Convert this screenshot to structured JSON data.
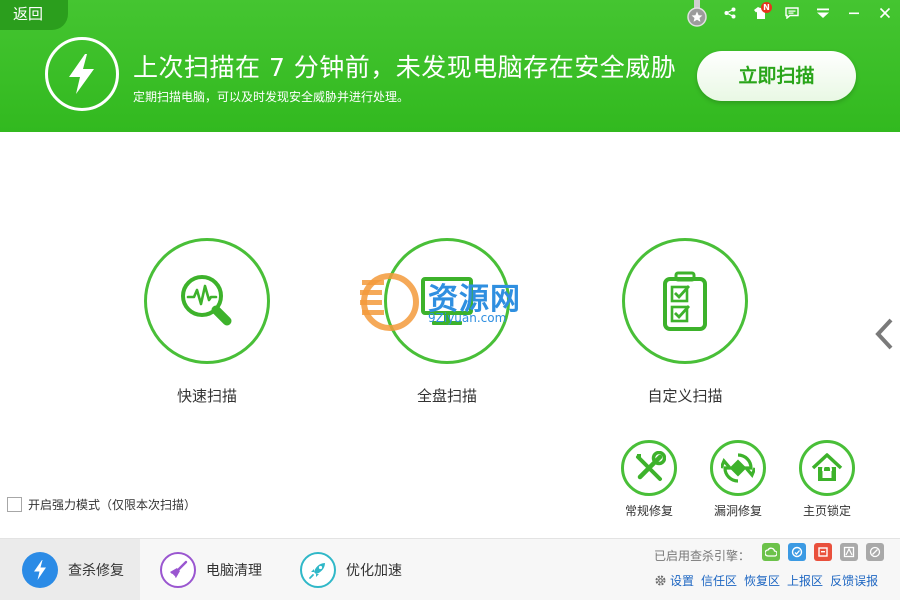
{
  "header": {
    "back_label": "返回",
    "title": "上次扫描在 7 分钟前，未发现电脑存在安全威胁",
    "subtitle": "定期扫描电脑，可以及时发现安全威胁并进行处理。",
    "scan_now_label": "立即扫描",
    "notification_badge": "N",
    "theme_color": "#3cbf28"
  },
  "scan_modes": [
    {
      "label": "快速扫描",
      "icon": "magnifier-pulse-icon"
    },
    {
      "label": "全盘扫描",
      "icon": "monitor-icon"
    },
    {
      "label": "自定义扫描",
      "icon": "clipboard-check-icon"
    }
  ],
  "watermark": {
    "text": "资源网",
    "url": "9Ziyuan.com"
  },
  "strong_mode": {
    "label": "开启强力模式（仅限本次扫描）",
    "checked": false
  },
  "tools": [
    {
      "label": "常规修复",
      "icon": "wrench-screwdriver-icon"
    },
    {
      "label": "漏洞修复",
      "icon": "vulnerability-repair-icon"
    },
    {
      "label": "主页锁定",
      "icon": "home-lock-icon"
    }
  ],
  "bottom_nav": [
    {
      "label": "查杀修复",
      "icon": "bolt-icon",
      "active": true
    },
    {
      "label": "电脑清理",
      "icon": "broom-icon",
      "active": false
    },
    {
      "label": "优化加速",
      "icon": "rocket-icon",
      "active": false
    }
  ],
  "engines": {
    "label": "已启用查杀引擎：",
    "items": [
      {
        "icon": "cloud-engine-icon",
        "color": "#6cc24a"
      },
      {
        "icon": "qvm-engine-icon",
        "color": "#3b9ae3"
      },
      {
        "icon": "system-repair-engine-icon",
        "color": "#e9503c"
      },
      {
        "icon": "avira-engine-icon",
        "color": "#a9a9a9"
      },
      {
        "icon": "bitdefender-engine-icon",
        "color": "#a9a9a9"
      }
    ]
  },
  "footer_links": [
    "设置",
    "信任区",
    "恢复区",
    "上报区",
    "反馈误报"
  ]
}
